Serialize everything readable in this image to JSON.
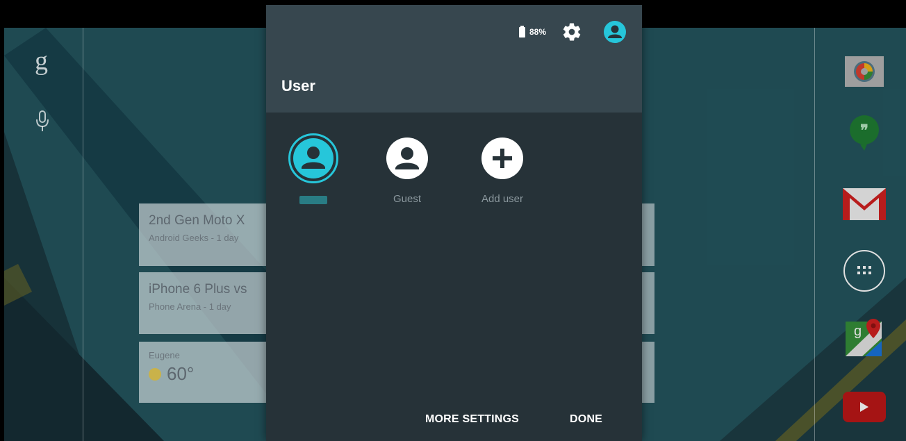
{
  "status_bar": {
    "battery_text": "88%"
  },
  "panel": {
    "title": "User",
    "users": [
      {
        "label": "",
        "active": true
      },
      {
        "label": "Guest",
        "active": false
      },
      {
        "label": "Add user",
        "active": false
      }
    ],
    "buttons": {
      "more_settings": "MORE SETTINGS",
      "done": "DONE"
    }
  },
  "background": {
    "search_glyph": "g",
    "cards": [
      {
        "title": "2nd Gen Moto X",
        "subtitle": "Android Geeks - 1 day"
      },
      {
        "title": "iPhone 6 Plus vs",
        "subtitle": "Phone Arena - 1 day"
      }
    ],
    "weather": {
      "city": "Eugene",
      "temp": "60°"
    }
  },
  "colors": {
    "accent": "#26c6da",
    "panel_bg": "#263238",
    "panel_header": "#37474f",
    "wallpaper": "#2f6f7c"
  },
  "icons": {
    "status": [
      "battery-icon",
      "gear-icon",
      "user-avatar-icon"
    ],
    "dock": [
      "camera-app-icon",
      "hangouts-icon",
      "gmail-icon",
      "app-drawer-icon",
      "maps-icon",
      "youtube-icon"
    ]
  }
}
